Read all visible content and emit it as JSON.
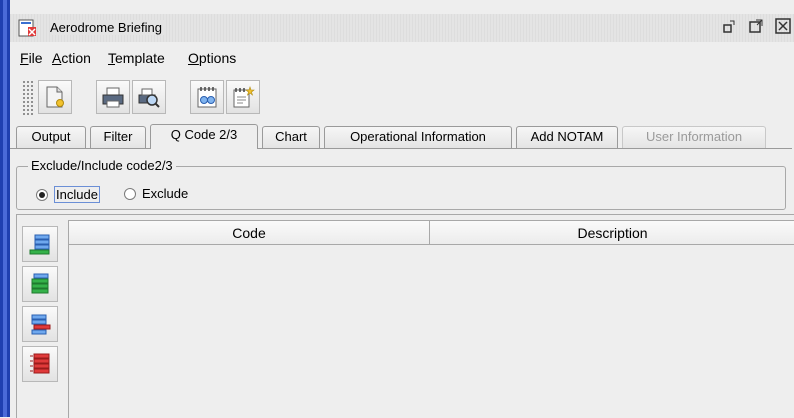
{
  "window": {
    "title": "Aerodrome Briefing",
    "controls": {
      "restore": "⧉",
      "maximize": "🗗",
      "close": "☒"
    }
  },
  "menu": [
    {
      "label": "File",
      "mnemonic": "F"
    },
    {
      "label": "Action",
      "mnemonic": "A"
    },
    {
      "label": "Template",
      "mnemonic": "T"
    },
    {
      "label": "Options",
      "mnemonic": "O"
    }
  ],
  "toolbar": {
    "icons": [
      "new-document-icon",
      "print-icon",
      "print-preview-icon",
      "notes-icon",
      "new-note-icon"
    ]
  },
  "tabs": [
    {
      "label": "Output",
      "state": "normal"
    },
    {
      "label": "Filter",
      "state": "normal"
    },
    {
      "label": "Q Code 2/3",
      "state": "active"
    },
    {
      "label": "Chart",
      "state": "normal"
    },
    {
      "label": "Operational Information",
      "state": "normal"
    },
    {
      "label": "Add NOTAM",
      "state": "normal"
    },
    {
      "label": "User Information",
      "state": "disabled"
    }
  ],
  "group": {
    "title": "Exclude/Include code2/3",
    "options": [
      {
        "label": "Include",
        "selected": true
      },
      {
        "label": "Exclude",
        "selected": false
      }
    ]
  },
  "side_buttons": [
    "add-row-icon",
    "insert-row-icon",
    "remove-row-icon",
    "clear-rows-icon"
  ],
  "table": {
    "columns": [
      "Code",
      "Description"
    ],
    "rows": []
  },
  "colors": {
    "frame": "#1f3fb0",
    "selection_border": "#6b8fd6",
    "icon_blue": "#3a6fd0",
    "icon_green": "#35b24a",
    "icon_red": "#e03a3a"
  }
}
